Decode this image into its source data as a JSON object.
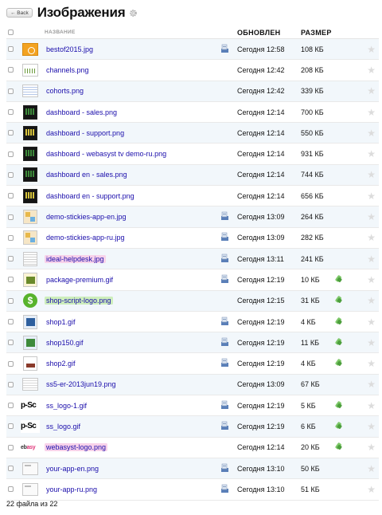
{
  "header": {
    "back_label": "← Back",
    "title": "Изображения",
    "settings_icon": "gear-icon"
  },
  "columns": {
    "name": "НАЗВАНИЕ",
    "updated": "ОБНОВЛЕН",
    "size": "РАЗМЕР"
  },
  "files": [
    {
      "name": "bestof2015.jpg",
      "thumb": "orange",
      "app_icon": true,
      "updated": "Сегодня 12:58",
      "size": "108 КБ",
      "pinned": false,
      "highlight": ""
    },
    {
      "name": "channels.png",
      "thumb": "chart",
      "app_icon": false,
      "updated": "Сегодня 12:42",
      "size": "208 КБ",
      "pinned": false,
      "highlight": ""
    },
    {
      "name": "cohorts.png",
      "thumb": "table",
      "app_icon": false,
      "updated": "Сегодня 12:42",
      "size": "339 КБ",
      "pinned": false,
      "highlight": ""
    },
    {
      "name": "dashboard - sales.png",
      "thumb": "dark",
      "app_icon": false,
      "updated": "Сегодня 12:14",
      "size": "700 КБ",
      "pinned": false,
      "highlight": ""
    },
    {
      "name": "dashboard - support.png",
      "thumb": "dark-b",
      "app_icon": false,
      "updated": "Сегодня 12:14",
      "size": "550 КБ",
      "pinned": false,
      "highlight": ""
    },
    {
      "name": "dashboard - webasyst tv demo-ru.png",
      "thumb": "dark",
      "app_icon": false,
      "updated": "Сегодня 12:14",
      "size": "931 КБ",
      "pinned": false,
      "highlight": ""
    },
    {
      "name": "dashboard en - sales.png",
      "thumb": "dark",
      "app_icon": false,
      "updated": "Сегодня 12:14",
      "size": "744 КБ",
      "pinned": false,
      "highlight": ""
    },
    {
      "name": "dashboard en - support.png",
      "thumb": "dark-b",
      "app_icon": false,
      "updated": "Сегодня 12:14",
      "size": "656 КБ",
      "pinned": false,
      "highlight": ""
    },
    {
      "name": "demo-stickies-app-en.jpg",
      "thumb": "sticky",
      "app_icon": true,
      "updated": "Сегодня 13:09",
      "size": "264 КБ",
      "pinned": false,
      "highlight": ""
    },
    {
      "name": "demo-stickies-app-ru.jpg",
      "thumb": "sticky",
      "app_icon": true,
      "updated": "Сегодня 13:09",
      "size": "282 КБ",
      "pinned": false,
      "highlight": ""
    },
    {
      "name": "ideal-helpdesk.jpg",
      "thumb": "doc",
      "app_icon": true,
      "updated": "Сегодня 13:11",
      "size": "241 КБ",
      "pinned": false,
      "highlight": "pink"
    },
    {
      "name": "package-premium.gif",
      "thumb": "pkg",
      "app_icon": true,
      "updated": "Сегодня 12:19",
      "size": "10 КБ",
      "pinned": true,
      "highlight": ""
    },
    {
      "name": "shop-script-logo.png",
      "thumb": "dollar",
      "app_icon": false,
      "updated": "Сегодня 12:15",
      "size": "31 КБ",
      "pinned": true,
      "highlight": "green"
    },
    {
      "name": "shop1.gif",
      "thumb": "shop",
      "app_icon": true,
      "updated": "Сегодня 12:19",
      "size": "4 КБ",
      "pinned": true,
      "highlight": ""
    },
    {
      "name": "shop150.gif",
      "thumb": "shop-b",
      "app_icon": true,
      "updated": "Сегодня 12:19",
      "size": "11 КБ",
      "pinned": true,
      "highlight": ""
    },
    {
      "name": "shop2.gif",
      "thumb": "shop-c",
      "app_icon": true,
      "updated": "Сегодня 12:19",
      "size": "4 КБ",
      "pinned": true,
      "highlight": ""
    },
    {
      "name": "ss5-er-2013jun19.png",
      "thumb": "ss5",
      "app_icon": false,
      "updated": "Сегодня 13:09",
      "size": "67 КБ",
      "pinned": false,
      "highlight": ""
    },
    {
      "name": "ss_logo-1.gif",
      "thumb": "txt",
      "thumb_text": "p-Sc",
      "app_icon": true,
      "updated": "Сегодня 12:19",
      "size": "5 КБ",
      "pinned": true,
      "highlight": ""
    },
    {
      "name": "ss_logo.gif",
      "thumb": "txt",
      "thumb_text": "p-Sc",
      "app_icon": true,
      "updated": "Сегодня 12:19",
      "size": "6 КБ",
      "pinned": true,
      "highlight": ""
    },
    {
      "name": "webasyst-logo.png",
      "thumb": "webasyst",
      "thumb_text": "ebasy",
      "app_icon": false,
      "updated": "Сегодня 12:14",
      "size": "20 КБ",
      "pinned": true,
      "highlight": "pink"
    },
    {
      "name": "your-app-en.png",
      "thumb": "app",
      "app_icon": true,
      "updated": "Сегодня 13:10",
      "size": "50 КБ",
      "pinned": false,
      "highlight": ""
    },
    {
      "name": "your-app-ru.png",
      "thumb": "app",
      "app_icon": true,
      "updated": "Сегодня 13:10",
      "size": "51 КБ",
      "pinned": false,
      "highlight": ""
    }
  ],
  "footer": {
    "count_text": "22 файла из 22"
  },
  "colors": {
    "link": "#1a0dab",
    "row_alt": "#f2f7fb",
    "highlight_pink": "#f8d2ea",
    "highlight_green": "#cdeebc"
  }
}
